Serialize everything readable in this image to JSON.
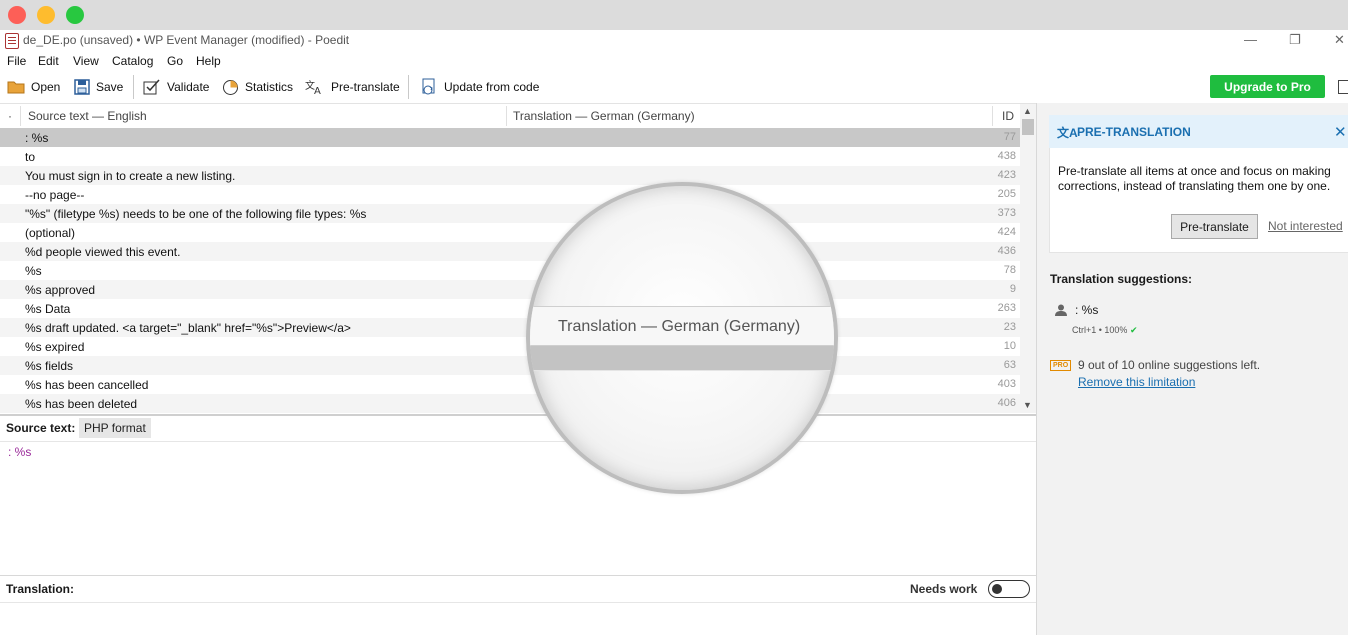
{
  "window": {
    "title": "de_DE.po (unsaved) • WP Event Manager (modified) - Poedit",
    "controls": {
      "minimize": "—",
      "restore": "❐",
      "close": "✕"
    }
  },
  "menu": [
    "File",
    "Edit",
    "View",
    "Catalog",
    "Go",
    "Help"
  ],
  "toolbar": {
    "open": "Open",
    "save": "Save",
    "validate": "Validate",
    "statistics": "Statistics",
    "pretranslate": "Pre-translate",
    "update": "Update from code",
    "upgrade": "Upgrade to Pro"
  },
  "list": {
    "headers": {
      "dot": "·",
      "source": "Source text — English",
      "translation": "Translation — German (Germany)",
      "id": "ID"
    },
    "rows": [
      {
        "src": ": %s",
        "id": "77"
      },
      {
        "src": "to",
        "id": "438"
      },
      {
        "src": "You must sign in to create a new listing.",
        "id": "423"
      },
      {
        "src": "--no page--",
        "id": "205"
      },
      {
        "src": "\"%s\" (filetype %s) needs to be one of the following file types: %s",
        "id": "373"
      },
      {
        "src": "(optional)",
        "id": "424"
      },
      {
        "src": "%d people viewed this event.",
        "id": "436"
      },
      {
        "src": "%s",
        "id": "78"
      },
      {
        "src": "%s approved",
        "id": "9"
      },
      {
        "src": "%s Data",
        "id": "263"
      },
      {
        "src": "%s draft updated. <a target=\"_blank\" href=\"%s\">Preview</a>",
        "id": "23"
      },
      {
        "src": "%s expired",
        "id": "10"
      },
      {
        "src": "%s fields",
        "id": "63"
      },
      {
        "src": "%s has been cancelled",
        "id": "403"
      },
      {
        "src": "%s has been deleted",
        "id": "406"
      }
    ]
  },
  "editor": {
    "source_label": "Source text:",
    "format_badge": "PHP format",
    "source_value": ": %s",
    "translation_label": "Translation:",
    "needs_work": "Needs work"
  },
  "sidebar": {
    "pretranslation": {
      "title": "PRE-TRANSLATION",
      "body": "Pre-translate all items at once and focus on making corrections, instead of translating them one by one.",
      "button": "Pre-translate",
      "dismiss": "Not interested"
    },
    "suggestions": {
      "title": "Translation suggestions:",
      "item": ": %s",
      "meta": "Ctrl+1 • 100%"
    },
    "pro": {
      "badge": "PRO",
      "text": "9 out of 10 online suggestions left.",
      "link": "Remove this limitation"
    }
  },
  "magnifier": {
    "text": "Translation — German (Germany)"
  },
  "colors": {
    "accent": "#1a6fb0",
    "upgrade": "#1fbd3f",
    "selected_row": "#c8c8c8",
    "stripe": "#f4f4f4"
  }
}
